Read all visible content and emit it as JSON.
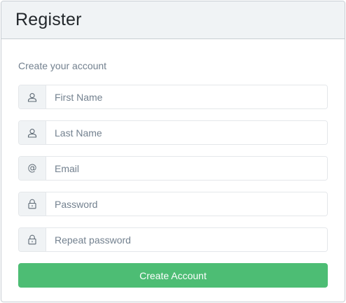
{
  "header": {
    "title": "Register"
  },
  "form": {
    "subtitle": "Create your account",
    "fields": [
      {
        "icon": "user-icon",
        "placeholder": "First Name",
        "value": ""
      },
      {
        "icon": "user-icon",
        "placeholder": "Last Name",
        "value": ""
      },
      {
        "icon": "at-icon",
        "icon_text": "@",
        "placeholder": "Email",
        "value": ""
      },
      {
        "icon": "lock-icon",
        "placeholder": "Password",
        "value": ""
      },
      {
        "icon": "lock-icon",
        "placeholder": "Repeat password",
        "value": ""
      }
    ],
    "submit_label": "Create Account"
  },
  "colors": {
    "header_bg": "#f0f3f5",
    "border": "#c8ced3",
    "button": "#4dbd74",
    "muted_text": "#73818f"
  }
}
